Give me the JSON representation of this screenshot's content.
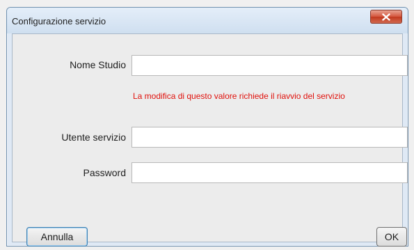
{
  "window": {
    "title": "Configurazione servizio",
    "close_icon": "close-x-icon"
  },
  "form": {
    "studio_name": {
      "label": "Nome Studio",
      "value": "",
      "warning": "La modifica di questo valore richiede il riavvio del servizio"
    },
    "service_user": {
      "label": "Utente servizio",
      "value": ""
    },
    "password": {
      "label": "Password",
      "value": ""
    }
  },
  "buttons": {
    "cancel_label": "Annulla",
    "ok_label": "OK"
  },
  "colors": {
    "warning": "#e0100b",
    "close_button": "#c9432a"
  }
}
